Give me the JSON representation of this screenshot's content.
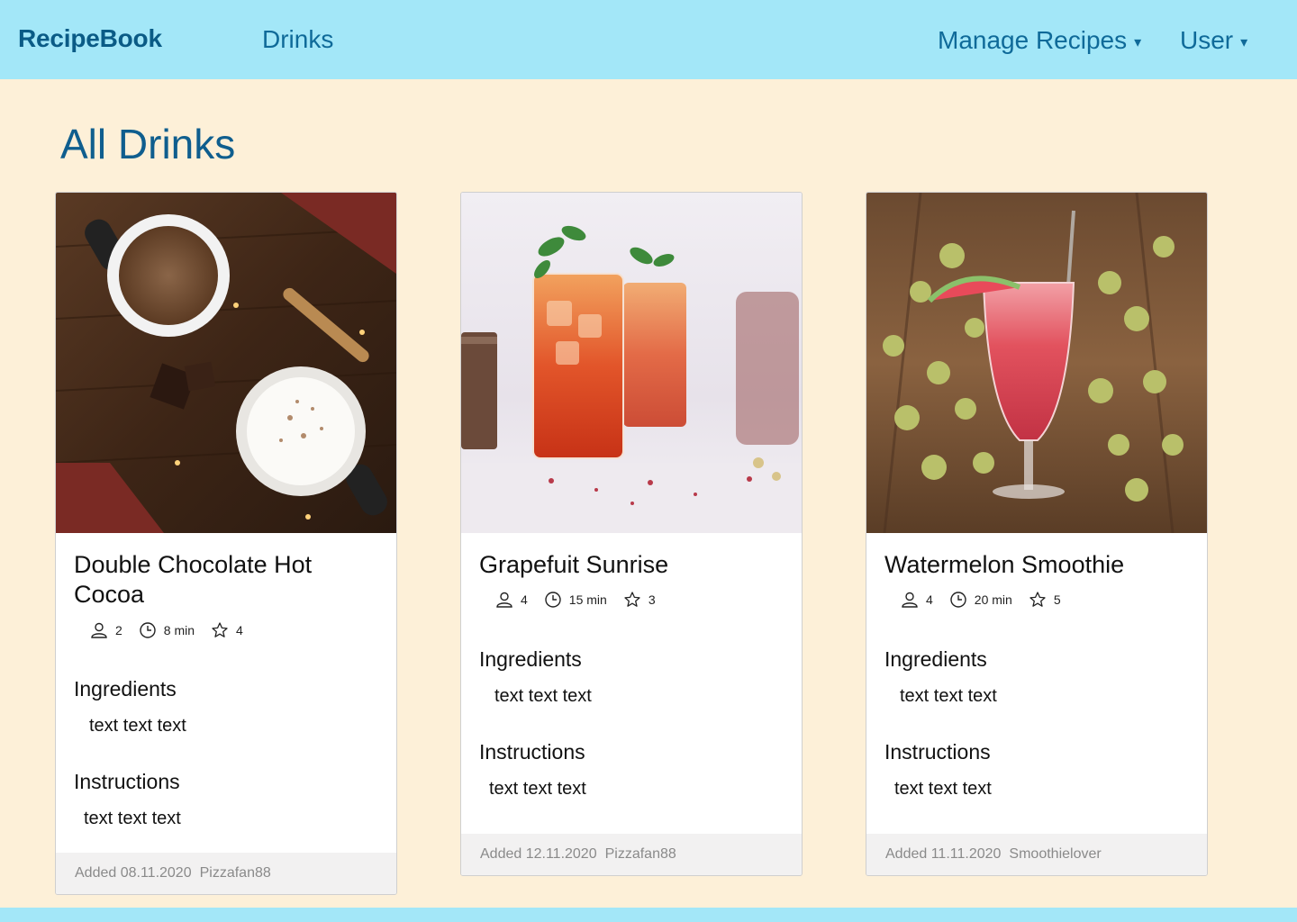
{
  "nav": {
    "brand": "RecipeBook",
    "drinks": "Drinks",
    "manage": "Manage Recipes",
    "user": "User",
    "caret": "▾"
  },
  "page": {
    "title": "All Drinks"
  },
  "colors": {
    "navbar": "#a3e7f8",
    "background": "#fdf0d8",
    "accent": "#0f6a99"
  },
  "cards": [
    {
      "title": "Double Chocolate Hot Cocoa",
      "image": "hot-cocoa-photo",
      "servings": "2",
      "time": "8 min",
      "rating": "4",
      "ingredients_label": "Ingredients",
      "ingredients": "text text text",
      "instructions_label": "Instructions",
      "instructions": "text text text",
      "added": "Added 08.11.2020",
      "author": "Pizzafan88"
    },
    {
      "title": "Grapefuit Sunrise",
      "image": "grapefruit-drink-photo",
      "servings": "4",
      "time": "15 min",
      "rating": "3",
      "ingredients_label": "Ingredients",
      "ingredients": "text text text",
      "instructions_label": "Instructions",
      "instructions": "text text text",
      "added": "Added 12.11.2020",
      "author": "Pizzafan88"
    },
    {
      "title": "Watermelon Smoothie",
      "image": "watermelon-smoothie-photo",
      "servings": "4",
      "time": "20 min",
      "rating": "5",
      "ingredients_label": "Ingredients",
      "ingredients": "text text text",
      "instructions_label": "Instructions",
      "instructions": "text text text",
      "added": "Added 11.11.2020",
      "author": "Smoothielover"
    }
  ]
}
